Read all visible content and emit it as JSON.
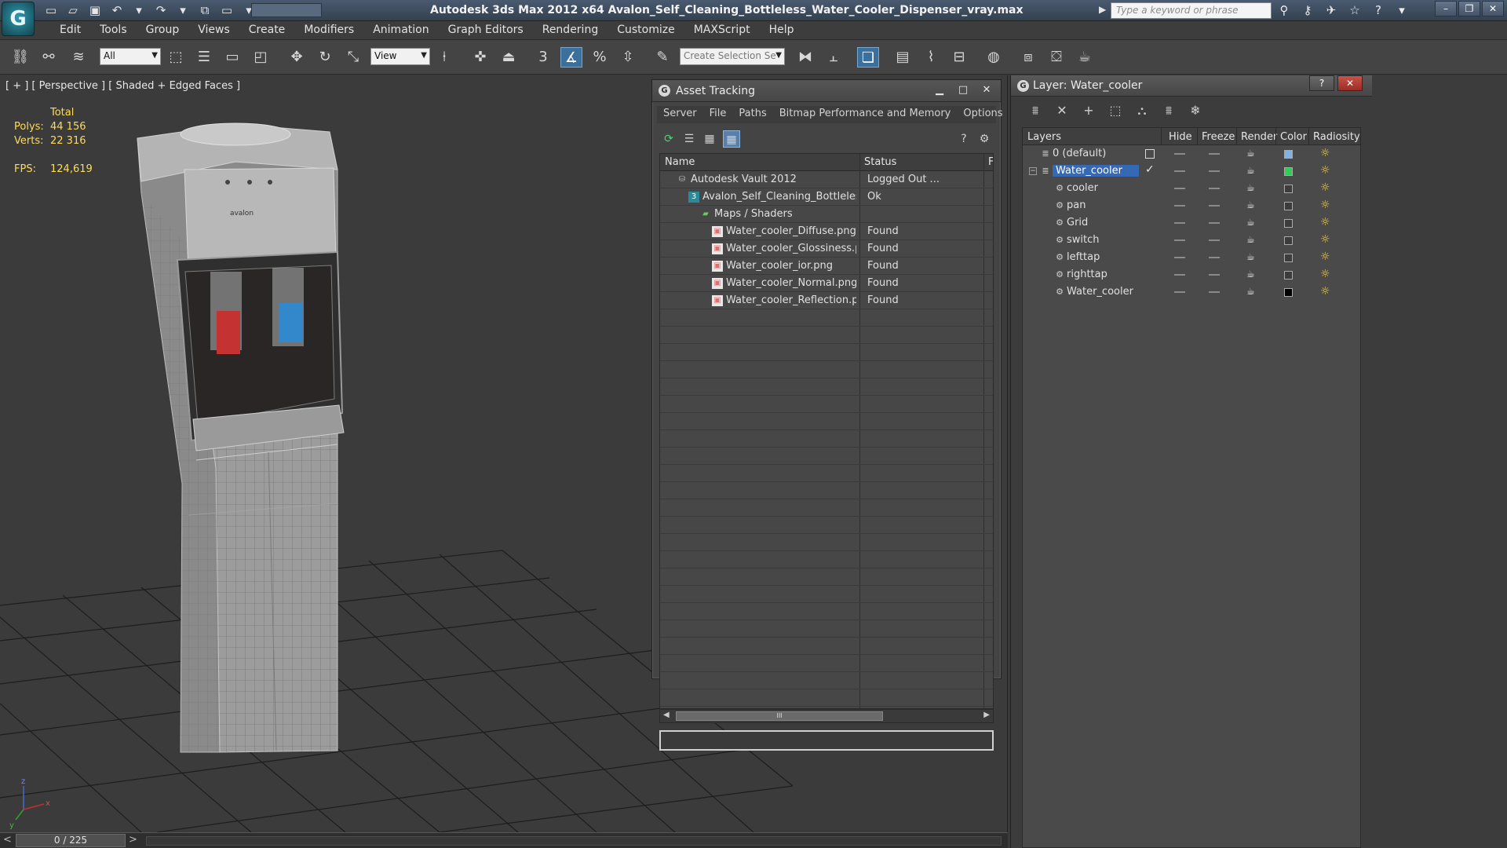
{
  "app": {
    "logo_glyph": "G",
    "title": "Autodesk 3ds Max  2012 x64      Avalon_Self_Cleaning_Bottleless_Water_Cooler_Dispenser_vray.max",
    "search_placeholder": "Type a keyword or phrase",
    "accent_color": "#3569b5"
  },
  "menu": [
    "Edit",
    "Tools",
    "Group",
    "Views",
    "Create",
    "Modifiers",
    "Animation",
    "Graph Editors",
    "Rendering",
    "Customize",
    "MAXScript",
    "Help"
  ],
  "toolbar": {
    "filter_value": "All",
    "refcoord_value": "View",
    "selection_set_placeholder": "Create Selection Se",
    "snap_3": "3"
  },
  "viewport": {
    "label": "[ + ] [ Perspective ] [ Shaded + Edged Faces ]",
    "stats_total": "Total",
    "polys_label": "Polys:",
    "polys_value": "44 156",
    "verts_label": "Verts:",
    "verts_value": "22 316",
    "fps_label": "FPS:",
    "fps_value": "124,619",
    "axis_labels": [
      "z",
      "x",
      "y"
    ],
    "brand_label": "avalon"
  },
  "timeline": {
    "frame": "0 / 225"
  },
  "asset_tracking": {
    "title": "Asset Tracking",
    "menu": [
      "Server",
      "File",
      "Paths",
      "Bitmap Performance and Memory",
      "Options"
    ],
    "columns": [
      "Name",
      "Status",
      "F"
    ],
    "rows": [
      {
        "name": "Autodesk Vault 2012",
        "status": "Logged Out ...",
        "indent": 1,
        "icon": "vault-icon"
      },
      {
        "name": "Avalon_Self_Cleaning_Bottleless_Water_Cooler...",
        "status": "Ok",
        "indent": 2,
        "icon": "max-file-icon"
      },
      {
        "name": "Maps / Shaders",
        "status": "",
        "indent": 3,
        "icon": "maps-folder-icon"
      },
      {
        "name": "Water_cooler_Diffuse.png",
        "status": "Found",
        "indent": 4,
        "icon": "bitmap-icon"
      },
      {
        "name": "Water_cooler_Glossiness.png",
        "status": "Found",
        "indent": 4,
        "icon": "bitmap-icon"
      },
      {
        "name": "Water_cooler_ior.png",
        "status": "Found",
        "indent": 4,
        "icon": "bitmap-icon"
      },
      {
        "name": "Water_cooler_Normal.png",
        "status": "Found",
        "indent": 4,
        "icon": "bitmap-icon"
      },
      {
        "name": "Water_cooler_Reflection.png",
        "status": "Found",
        "indent": 4,
        "icon": "bitmap-icon"
      }
    ],
    "hscroll_grip": "III"
  },
  "layers": {
    "title": "Layer: Water_cooler",
    "columns": [
      "Layers",
      "Hide",
      "Freeze",
      "Render",
      "Color",
      "Radiosity"
    ],
    "rows": [
      {
        "name": "0 (default)",
        "level": 0,
        "color": "#7fb3e6",
        "current": false,
        "selected": false
      },
      {
        "name": "Water_cooler",
        "level": 0,
        "color": "#33cc55",
        "current": true,
        "selected": true
      },
      {
        "name": "cooler",
        "level": 1,
        "color": "#3c3c3c",
        "current": false,
        "selected": false
      },
      {
        "name": "pan",
        "level": 1,
        "color": "#3c3c3c",
        "current": false,
        "selected": false
      },
      {
        "name": "Grid",
        "level": 1,
        "color": "#3c3c3c",
        "current": false,
        "selected": false
      },
      {
        "name": "switch",
        "level": 1,
        "color": "#3c3c3c",
        "current": false,
        "selected": false
      },
      {
        "name": "lefttap",
        "level": 1,
        "color": "#3c3c3c",
        "current": false,
        "selected": false
      },
      {
        "name": "righttap",
        "level": 1,
        "color": "#3c3c3c",
        "current": false,
        "selected": false
      },
      {
        "name": "Water_cooler",
        "level": 1,
        "color": "#000000",
        "current": false,
        "selected": false
      }
    ]
  }
}
